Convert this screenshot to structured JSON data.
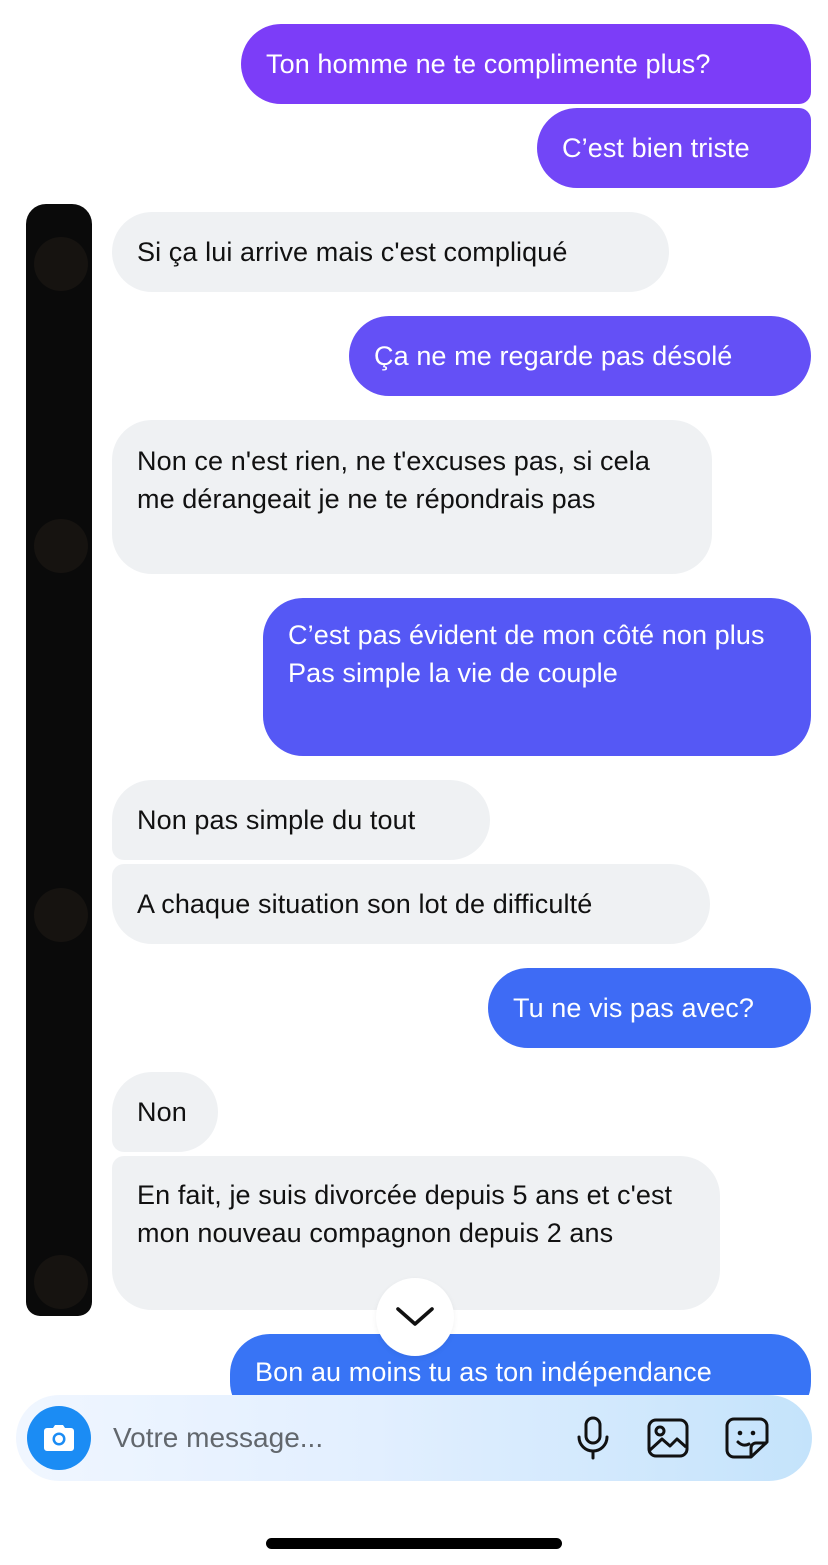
{
  "colors": {
    "outgoing_top": "#7b3ff9",
    "outgoing_mid": "#5b55f4",
    "outgoing_bottom": "#3a6ff5",
    "incoming_bg": "#eff1f3",
    "camera_button": "#1b8cf4"
  },
  "messages": [
    {
      "side": "out",
      "text": "Ton homme ne te complimente plus?"
    },
    {
      "side": "out",
      "text": "C’est bien triste"
    },
    {
      "side": "in",
      "text": "Si ça lui arrive mais c'est compliqué"
    },
    {
      "side": "out",
      "text": "Ça ne me regarde pas désolé"
    },
    {
      "side": "in",
      "text": "Non ce n'est rien, ne t'excuses pas, si cela me dérangeait je ne te répondrais pas"
    },
    {
      "side": "out",
      "text": "C’est pas évident de mon côté non plus\nPas simple la vie de couple"
    },
    {
      "side": "in",
      "text": "Non pas simple du tout"
    },
    {
      "side": "in",
      "text": "A chaque situation son lot de difficulté"
    },
    {
      "side": "out",
      "text": "Tu ne vis pas avec?"
    },
    {
      "side": "in",
      "text": "Non"
    },
    {
      "side": "in",
      "text": "En fait, je suis divorcée depuis 5 ans et c'est mon nouveau compagnon depuis 2 ans"
    },
    {
      "side": "out",
      "text": "Bon au moins tu as ton indépendance"
    }
  ],
  "composer": {
    "placeholder": "Votre message...",
    "icons": [
      "camera-icon",
      "microphone-icon",
      "image-icon",
      "sticker-icon"
    ]
  },
  "scroll_button_icon": "chevron-down-icon"
}
